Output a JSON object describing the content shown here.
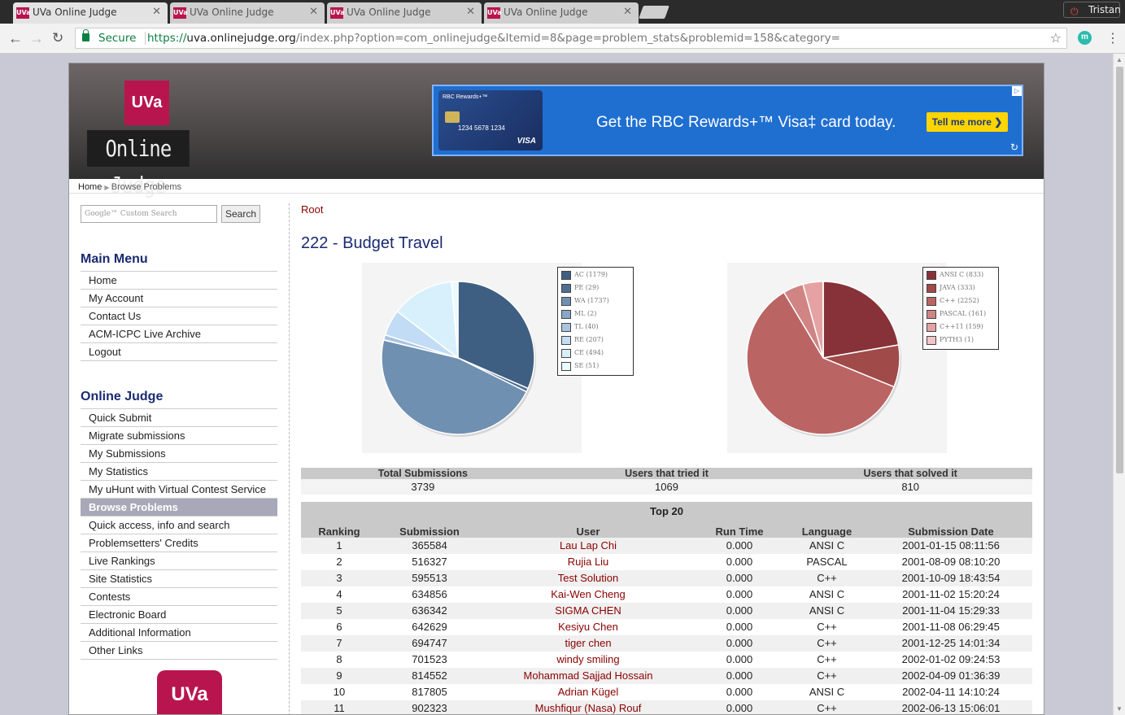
{
  "browser": {
    "tabs": [
      {
        "title": "UVa Online Judge",
        "active": true
      },
      {
        "title": "UVa Online Judge",
        "active": false
      },
      {
        "title": "UVa Online Judge",
        "active": false
      },
      {
        "title": "UVa Online Judge",
        "active": false
      }
    ],
    "favicon_text": "UVa",
    "profile_name": "Tristan",
    "secure_label": "Secure",
    "url_scheme": "https://",
    "url_host": "uva.onlinejudge.org",
    "url_path": "/index.php?option=com_onlinejudge&Itemid=8&page=problem_stats&problemid=158&category=",
    "extension_letter": "m"
  },
  "header": {
    "logo_box": "UVa",
    "logo_text": "Online Judge",
    "ad": {
      "card_brand": "RBC Rewards+™",
      "card_number": "1234 5678 1234",
      "card_network": "VISA",
      "headline": "Get the RBC Rewards+™ Visa‡ card today.",
      "button": "Tell me more ❯"
    }
  },
  "breadcrumb": {
    "home": "Home",
    "current": "Browse Problems"
  },
  "search": {
    "placeholder": "Google™ Custom Search",
    "button": "Search"
  },
  "main_menu": {
    "title": "Main Menu",
    "items": [
      "Home",
      "My Account",
      "Contact Us",
      "ACM-ICPC Live Archive",
      "Logout"
    ]
  },
  "online_judge_menu": {
    "title": "Online Judge",
    "items": [
      "Quick Submit",
      "Migrate submissions",
      "My Submissions",
      "My Statistics",
      "My uHunt with Virtual Contest Service",
      "Browse Problems",
      "Quick access, info and search",
      "Problemsetters' Credits",
      "Live Rankings",
      "Site Statistics",
      "Contests",
      "Electronic Board",
      "Additional Information",
      "Other Links"
    ],
    "active": "Browse Problems"
  },
  "bottom_logo": "UVa",
  "content": {
    "root_link": "Root",
    "problem_title": "222 - Budget Travel"
  },
  "chart_data": [
    {
      "type": "pie",
      "title": "",
      "categories": [
        "AC (1179)",
        "PE (29)",
        "WA (1737)",
        "ML (2)",
        "TL (40)",
        "RE (207)",
        "CE (494)",
        "SE (51)"
      ],
      "values": [
        1179,
        29,
        1737,
        2,
        40,
        207,
        494,
        51
      ],
      "colors": [
        "#3f5f82",
        "#4f6f92",
        "#7090b2",
        "#8aa6c6",
        "#a8c4e0",
        "#c2dcf5",
        "#d8f0fc",
        "#eafaff"
      ],
      "legend": "top-right"
    },
    {
      "type": "pie",
      "title": "",
      "categories": [
        "ANSI C (833)",
        "JAVA (333)",
        "C++ (2252)",
        "PASCAL (161)",
        "C++11 (159)",
        "PYTH3 (1)"
      ],
      "values": [
        833,
        333,
        2252,
        161,
        159,
        1
      ],
      "colors": [
        "#873238",
        "#a04a4a",
        "#bb6464",
        "#d08484",
        "#e6a2a2",
        "#f2c6c6"
      ],
      "legend": "top-right"
    }
  ],
  "stats": {
    "headers": [
      "Total Submissions",
      "Users that tried it",
      "Users that solved it"
    ],
    "values": [
      "3739",
      "1069",
      "810"
    ]
  },
  "top20": {
    "title": "Top 20",
    "headers": [
      "Ranking",
      "Submission",
      "User",
      "Run Time",
      "Language",
      "Submission Date"
    ],
    "rows": [
      [
        "1",
        "365584",
        "Lau Lap Chi",
        "0.000",
        "ANSI C",
        "2001-01-15 08:11:56"
      ],
      [
        "2",
        "516327",
        "Rujia Liu",
        "0.000",
        "PASCAL",
        "2001-08-09 08:10:20"
      ],
      [
        "3",
        "595513",
        "Test Solution",
        "0.000",
        "C++",
        "2001-10-09 18:43:54"
      ],
      [
        "4",
        "634856",
        "Kai-Wen Cheng",
        "0.000",
        "ANSI C",
        "2001-11-02 15:20:24"
      ],
      [
        "5",
        "636342",
        "SIGMA CHEN",
        "0.000",
        "ANSI C",
        "2001-11-04 15:29:33"
      ],
      [
        "6",
        "642629",
        "Kesiyu Chen",
        "0.000",
        "C++",
        "2001-11-08 06:29:45"
      ],
      [
        "7",
        "694747",
        "tiger chen",
        "0.000",
        "C++",
        "2001-12-25 14:01:34"
      ],
      [
        "8",
        "701523",
        "windy smiling",
        "0.000",
        "C++",
        "2002-01-02 09:24:53"
      ],
      [
        "9",
        "814552",
        "Mohammad Sajjad Hossain",
        "0.000",
        "C++",
        "2002-04-09 01:36:39"
      ],
      [
        "10",
        "817805",
        "Adrian Kügel",
        "0.000",
        "ANSI C",
        "2002-04-11 14:10:24"
      ],
      [
        "11",
        "902323",
        "Mushfiqur (Nasa) Rouf",
        "0.000",
        "C++",
        "2002-06-13 15:06:01"
      ]
    ]
  }
}
